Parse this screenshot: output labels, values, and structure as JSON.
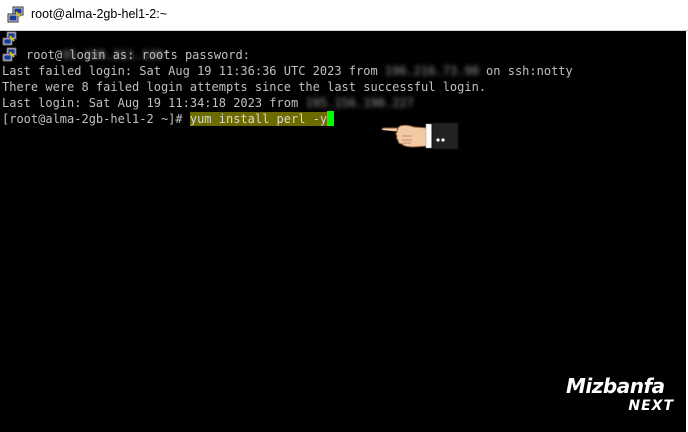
{
  "window": {
    "title": "root@alma-2gb-hel1-2:~"
  },
  "terminal": {
    "lines": [
      {
        "text": "login as: root"
      },
      {
        "prefix": "root@",
        "blurred": "95.100.211.130",
        "suffix": "'s password:"
      },
      {
        "prefix": "Last failed login: Sat Aug 19 11:36:36 UTC 2023 from ",
        "blurred": "196.216.73.90",
        "suffix": " on ssh:notty"
      },
      {
        "text": "There were 8 failed login attempts since the last successful login."
      },
      {
        "prefix": "Last login: Sat Aug 19 11:34:18 2023 from ",
        "blurred": "195.156.190.227"
      },
      {
        "prompt": "[root@alma-2gb-hel1-2 ~]# ",
        "command": "yum install perl -y"
      }
    ]
  },
  "logo": {
    "main": "Mizbanfa",
    "sub": "NEXT"
  },
  "colors": {
    "terminal_bg": "#000000",
    "terminal_fg": "#c0c0c0",
    "highlight": "#6b6b00",
    "cursor": "#00ff00"
  },
  "icons": {
    "title_icon": "putty-icon",
    "line_icon": "putty-icon",
    "pointer": "pointing-hand-icon"
  }
}
